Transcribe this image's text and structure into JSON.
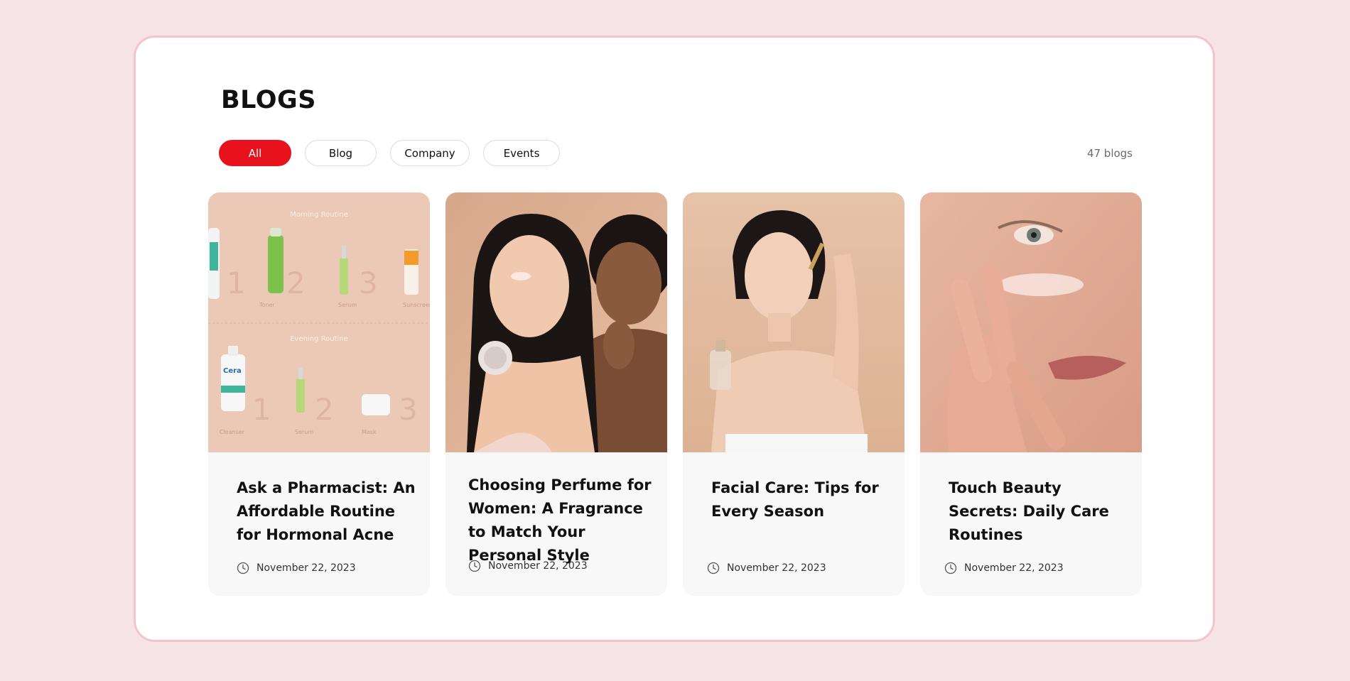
{
  "page": {
    "title": "BLOGS",
    "count_label": "47 blogs"
  },
  "filters": [
    {
      "label": "All",
      "active": true
    },
    {
      "label": "Blog",
      "active": false
    },
    {
      "label": "Company",
      "active": false
    },
    {
      "label": "Events",
      "active": false
    }
  ],
  "cards": [
    {
      "title": "Ask a Pharmacist: An Affordable Routine for Hormonal Acne",
      "date": "November 22, 2023",
      "image": {
        "top_heading": "Morning Routine",
        "bottom_heading": "Evening Routine",
        "morning_steps": [
          "Toner",
          "Serum",
          "Sunscreen"
        ],
        "evening_steps": [
          "Cleanser",
          "Serum",
          "Mask"
        ],
        "brand": "Cera",
        "step_numbers": [
          "1",
          "2",
          "3"
        ]
      }
    },
    {
      "title": "Choosing Perfume for Women: A Fragrance to Match Your Personal Style",
      "date": "November 22, 2023"
    },
    {
      "title": "Facial Care: Tips for Every Season",
      "date": "November 22, 2023"
    },
    {
      "title": "Touch Beauty Secrets: Daily Care Routines",
      "date": "November 22, 2023"
    }
  ],
  "colors": {
    "accent": "#e8121c",
    "page_bg": "#f6e3e6",
    "frame_border": "#f4c3cb",
    "card_bg": "#f8f8f8"
  },
  "icons": {
    "date": "clock-icon"
  }
}
